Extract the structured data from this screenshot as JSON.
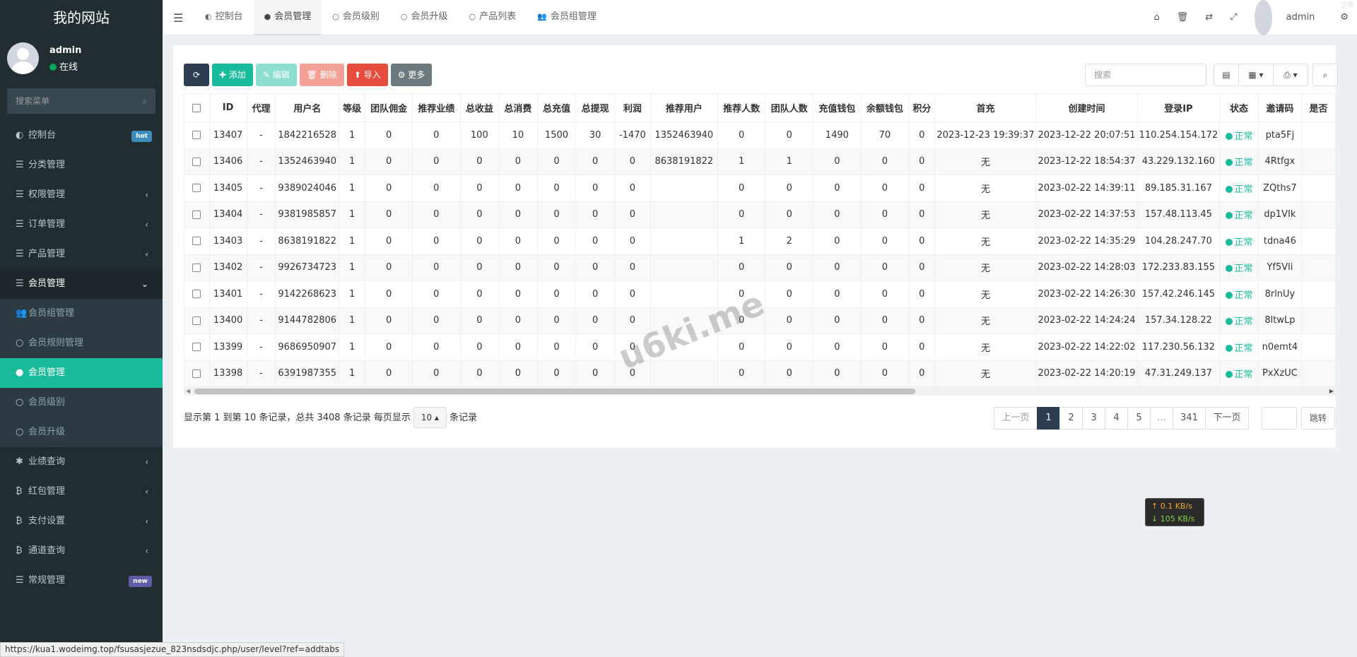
{
  "sidebar": {
    "logo": "我的网站",
    "user": {
      "name": "admin",
      "status": "在线"
    },
    "search_placeholder": "搜索菜单",
    "items": [
      {
        "icon": "dashboard-icon",
        "glyph": "◐",
        "label": "控制台",
        "badge": "hot",
        "badge_color": "#3c8dbc"
      },
      {
        "icon": "list-icon",
        "glyph": "☰",
        "label": "分类管理"
      },
      {
        "icon": "list-icon",
        "glyph": "☰",
        "label": "权限管理",
        "arrow": "‹"
      },
      {
        "icon": "list-icon",
        "glyph": "☰",
        "label": "订单管理",
        "arrow": "‹"
      },
      {
        "icon": "list-icon",
        "glyph": "☰",
        "label": "产品管理",
        "arrow": "‹"
      },
      {
        "icon": "list-icon",
        "glyph": "☰",
        "label": "会员管理",
        "arrow": "⌄"
      }
    ],
    "sub_items": [
      {
        "icon": "users-icon",
        "glyph": "👥",
        "label": "会员组管理"
      },
      {
        "icon": "circle-icon",
        "glyph": "○",
        "label": "会员规则管理"
      },
      {
        "icon": "user-icon",
        "glyph": "●",
        "label": "会员管理"
      },
      {
        "icon": "circle-icon",
        "glyph": "○",
        "label": "会员级别"
      },
      {
        "icon": "circle-icon",
        "glyph": "○",
        "label": "会员升级"
      }
    ],
    "items2": [
      {
        "icon": "asterisk-icon",
        "glyph": "✱",
        "label": "业绩查询",
        "arrow": "‹"
      },
      {
        "icon": "bitcoin-icon",
        "glyph": "₿",
        "label": "红包管理",
        "arrow": "‹"
      },
      {
        "icon": "bitcoin-icon",
        "glyph": "₿",
        "label": "支付设置",
        "arrow": "‹"
      },
      {
        "icon": "bitcoin-icon",
        "glyph": "₿",
        "label": "通道查询",
        "arrow": "‹"
      },
      {
        "icon": "list-icon",
        "glyph": "☰",
        "label": "常规管理",
        "badge": "new",
        "badge_color": "#605ca8"
      }
    ]
  },
  "topbar": {
    "tabs": [
      {
        "glyph": "◐",
        "label": "控制台"
      },
      {
        "glyph": "●",
        "label": "会员管理"
      },
      {
        "glyph": "○",
        "label": "会员级别"
      },
      {
        "glyph": "○",
        "label": "会员升级"
      },
      {
        "glyph": "○",
        "label": "产品列表"
      },
      {
        "glyph": "👥",
        "label": "会员组管理"
      }
    ],
    "user": "admin"
  },
  "toolbar": {
    "add": "✚ 添加",
    "edit": "✎ 编辑",
    "delete": "🗑 删除",
    "import": "⬆ 导入",
    "more": "⚙ 更多",
    "search_placeholder": "搜索"
  },
  "table": {
    "headers": [
      "ID",
      "代理",
      "用户名",
      "等级",
      "团队佣金",
      "推荐业绩",
      "总收益",
      "总消费",
      "总充值",
      "总提现",
      "利润",
      "推荐用户",
      "推荐人数",
      "团队人数",
      "充值钱包",
      "余额钱包",
      "积分",
      "首充",
      "创建时间",
      "登录IP",
      "状态",
      "邀请码",
      "是否"
    ],
    "rows": [
      [
        "13407",
        "-",
        "1842216528",
        "1",
        "0",
        "0",
        "100",
        "10",
        "1500",
        "30",
        "-1470",
        "1352463940",
        "0",
        "0",
        "1490",
        "70",
        "0",
        "2023-12-23 19:39:37",
        "2023-12-22 20:07:51",
        "110.254.154.172",
        "正常",
        "pta5Fj",
        ""
      ],
      [
        "13406",
        "-",
        "1352463940",
        "1",
        "0",
        "0",
        "0",
        "0",
        "0",
        "0",
        "0",
        "8638191822",
        "1",
        "1",
        "0",
        "0",
        "0",
        "无",
        "2023-12-22 18:54:37",
        "43.229.132.160",
        "正常",
        "4Rtfgx",
        ""
      ],
      [
        "13405",
        "-",
        "9389024046",
        "1",
        "0",
        "0",
        "0",
        "0",
        "0",
        "0",
        "0",
        "",
        "0",
        "0",
        "0",
        "0",
        "0",
        "无",
        "2023-02-22 14:39:11",
        "89.185.31.167",
        "正常",
        "ZQths7",
        ""
      ],
      [
        "13404",
        "-",
        "9381985857",
        "1",
        "0",
        "0",
        "0",
        "0",
        "0",
        "0",
        "0",
        "",
        "0",
        "0",
        "0",
        "0",
        "0",
        "无",
        "2023-02-22 14:37:53",
        "157.48.113.45",
        "正常",
        "dp1VIk",
        ""
      ],
      [
        "13403",
        "-",
        "8638191822",
        "1",
        "0",
        "0",
        "0",
        "0",
        "0",
        "0",
        "0",
        "",
        "1",
        "2",
        "0",
        "0",
        "0",
        "无",
        "2023-02-22 14:35:29",
        "104.28.247.70",
        "正常",
        "tdna46",
        ""
      ],
      [
        "13402",
        "-",
        "9926734723",
        "1",
        "0",
        "0",
        "0",
        "0",
        "0",
        "0",
        "0",
        "",
        "0",
        "0",
        "0",
        "0",
        "0",
        "无",
        "2023-02-22 14:28:03",
        "172.233.83.155",
        "正常",
        "Yf5Vli",
        ""
      ],
      [
        "13401",
        "-",
        "9142268623",
        "1",
        "0",
        "0",
        "0",
        "0",
        "0",
        "0",
        "0",
        "",
        "0",
        "0",
        "0",
        "0",
        "0",
        "无",
        "2023-02-22 14:26:30",
        "157.42.246.145",
        "正常",
        "8rlnUy",
        ""
      ],
      [
        "13400",
        "-",
        "9144782806",
        "1",
        "0",
        "0",
        "0",
        "0",
        "0",
        "0",
        "0",
        "",
        "0",
        "0",
        "0",
        "0",
        "0",
        "无",
        "2023-02-22 14:24:24",
        "157.34.128.22",
        "正常",
        "8ltwLp",
        ""
      ],
      [
        "13399",
        "-",
        "9686950907",
        "1",
        "0",
        "0",
        "0",
        "0",
        "0",
        "0",
        "0",
        "",
        "0",
        "0",
        "0",
        "0",
        "0",
        "无",
        "2023-02-22 14:22:02",
        "117.230.56.132",
        "正常",
        "n0emt4",
        ""
      ],
      [
        "13398",
        "-",
        "6391987355",
        "1",
        "0",
        "0",
        "0",
        "0",
        "0",
        "0",
        "0",
        "",
        "0",
        "0",
        "0",
        "0",
        "0",
        "无",
        "2023-02-22 14:20:19",
        "47.31.249.137",
        "正常",
        "PxXzUC",
        ""
      ]
    ]
  },
  "pagination": {
    "info_prefix": "显示第 1 到第 10 条记录，总共 3408 条记录 每页显示",
    "page_size": "10 ▴",
    "info_suffix": "条记录",
    "prev": "上一页",
    "pages": [
      "1",
      "2",
      "3",
      "4",
      "5",
      "...",
      "341"
    ],
    "next": "下一页",
    "jump": "跳转"
  },
  "network": {
    "up": "↑ 0.1 KB/s",
    "down": "↓ 105 KB/s"
  },
  "watermark": "u6ki.me",
  "corner_mark": "正常",
  "status_url": "https://kua1.wodeimg.top/fsusasjezue_823nsdsdjc.php/user/level?ref=addtabs"
}
